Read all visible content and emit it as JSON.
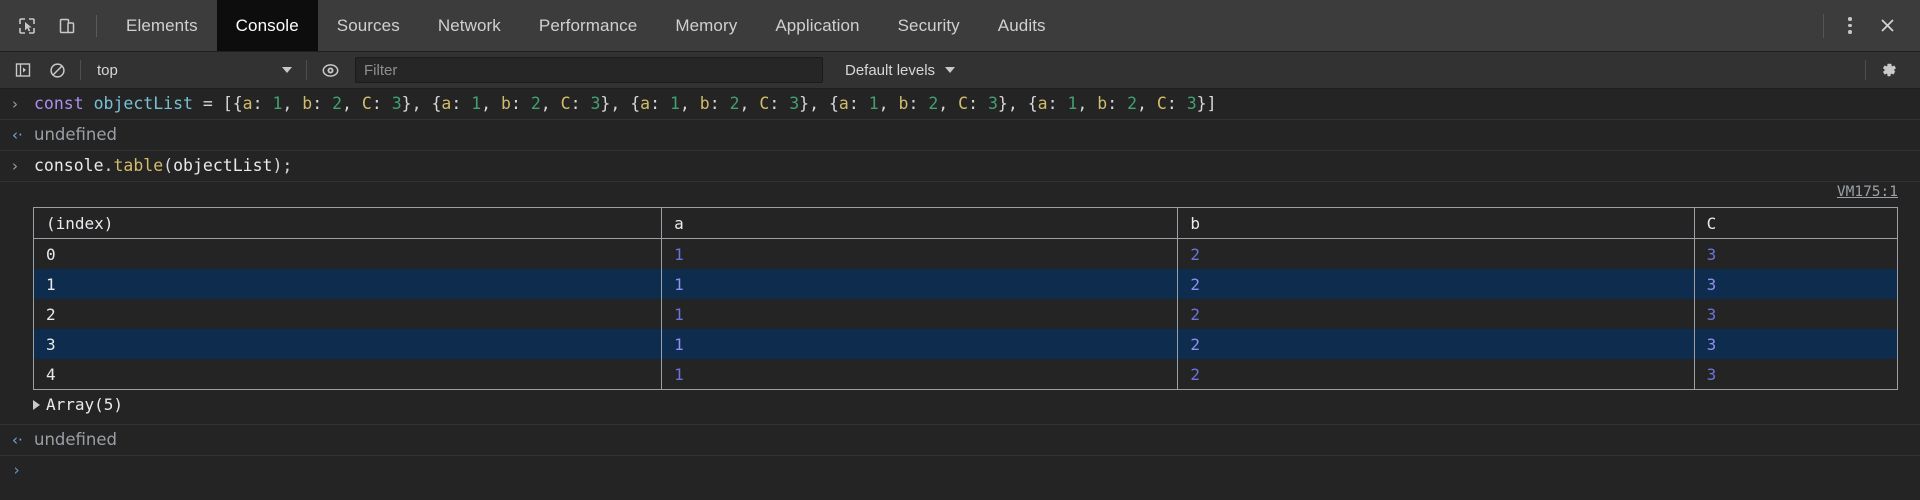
{
  "tabbar": {
    "inspect_icon": "inspect-cursor-icon",
    "device_icon": "device-toolbar-icon",
    "tabs": [
      {
        "label": "Elements",
        "active": false
      },
      {
        "label": "Console",
        "active": true
      },
      {
        "label": "Sources",
        "active": false
      },
      {
        "label": "Network",
        "active": false
      },
      {
        "label": "Performance",
        "active": false
      },
      {
        "label": "Memory",
        "active": false
      },
      {
        "label": "Application",
        "active": false
      },
      {
        "label": "Security",
        "active": false
      },
      {
        "label": "Audits",
        "active": false
      }
    ],
    "more_icon": "kebab-menu-icon",
    "close_icon": "close-icon"
  },
  "console_toolbar": {
    "sidebar_toggle_icon": "console-sidebar-icon",
    "clear_icon": "clear-console-icon",
    "context_value": "top",
    "eye_icon": "live-expression-eye-icon",
    "filter_placeholder": "Filter",
    "filter_value": "",
    "levels_label": "Default levels",
    "settings_icon": "gear-icon"
  },
  "console": {
    "messages": [
      {
        "kind": "input",
        "marker": "›",
        "tokens": [
          {
            "t": "const",
            "c": "kw"
          },
          {
            "t": " ",
            "c": "plain"
          },
          {
            "t": "objectList",
            "c": "var"
          },
          {
            "t": " ",
            "c": "plain"
          },
          {
            "t": "=",
            "c": "op"
          },
          {
            "t": " [{",
            "c": "punc"
          },
          {
            "t": "a",
            "c": "prop"
          },
          {
            "t": ": ",
            "c": "punc"
          },
          {
            "t": "1",
            "c": "num"
          },
          {
            "t": ", ",
            "c": "punc"
          },
          {
            "t": "b",
            "c": "prop"
          },
          {
            "t": ": ",
            "c": "punc"
          },
          {
            "t": "2",
            "c": "num"
          },
          {
            "t": ", ",
            "c": "punc"
          },
          {
            "t": "C",
            "c": "prop"
          },
          {
            "t": ": ",
            "c": "punc"
          },
          {
            "t": "3",
            "c": "num"
          },
          {
            "t": "}, {",
            "c": "punc"
          },
          {
            "t": "a",
            "c": "prop"
          },
          {
            "t": ": ",
            "c": "punc"
          },
          {
            "t": "1",
            "c": "num"
          },
          {
            "t": ", ",
            "c": "punc"
          },
          {
            "t": "b",
            "c": "prop"
          },
          {
            "t": ": ",
            "c": "punc"
          },
          {
            "t": "2",
            "c": "num"
          },
          {
            "t": ", ",
            "c": "punc"
          },
          {
            "t": "C",
            "c": "prop"
          },
          {
            "t": ": ",
            "c": "punc"
          },
          {
            "t": "3",
            "c": "num"
          },
          {
            "t": "}, {",
            "c": "punc"
          },
          {
            "t": "a",
            "c": "prop"
          },
          {
            "t": ": ",
            "c": "punc"
          },
          {
            "t": "1",
            "c": "num"
          },
          {
            "t": ", ",
            "c": "punc"
          },
          {
            "t": "b",
            "c": "prop"
          },
          {
            "t": ": ",
            "c": "punc"
          },
          {
            "t": "2",
            "c": "num"
          },
          {
            "t": ", ",
            "c": "punc"
          },
          {
            "t": "C",
            "c": "prop"
          },
          {
            "t": ": ",
            "c": "punc"
          },
          {
            "t": "3",
            "c": "num"
          },
          {
            "t": "}, {",
            "c": "punc"
          },
          {
            "t": "a",
            "c": "prop"
          },
          {
            "t": ": ",
            "c": "punc"
          },
          {
            "t": "1",
            "c": "num"
          },
          {
            "t": ", ",
            "c": "punc"
          },
          {
            "t": "b",
            "c": "prop"
          },
          {
            "t": ": ",
            "c": "punc"
          },
          {
            "t": "2",
            "c": "num"
          },
          {
            "t": ", ",
            "c": "punc"
          },
          {
            "t": "C",
            "c": "prop"
          },
          {
            "t": ": ",
            "c": "punc"
          },
          {
            "t": "3",
            "c": "num"
          },
          {
            "t": "}, {",
            "c": "punc"
          },
          {
            "t": "a",
            "c": "prop"
          },
          {
            "t": ": ",
            "c": "punc"
          },
          {
            "t": "1",
            "c": "num"
          },
          {
            "t": ", ",
            "c": "punc"
          },
          {
            "t": "b",
            "c": "prop"
          },
          {
            "t": ": ",
            "c": "punc"
          },
          {
            "t": "2",
            "c": "num"
          },
          {
            "t": ", ",
            "c": "punc"
          },
          {
            "t": "C",
            "c": "prop"
          },
          {
            "t": ": ",
            "c": "punc"
          },
          {
            "t": "3",
            "c": "num"
          },
          {
            "t": "}]",
            "c": "punc"
          }
        ]
      },
      {
        "kind": "output",
        "marker": "‹·",
        "text": "undefined"
      },
      {
        "kind": "input",
        "marker": "›",
        "tokens": [
          {
            "t": "console",
            "c": "plain"
          },
          {
            "t": ".",
            "c": "punc"
          },
          {
            "t": "table",
            "c": "fn"
          },
          {
            "t": "(",
            "c": "punc"
          },
          {
            "t": "objectList",
            "c": "plain"
          },
          {
            "t": ");",
            "c": "punc"
          }
        ]
      }
    ],
    "table_block": {
      "source_link": "VM175:1",
      "columns": [
        "(index)",
        "a",
        "b",
        "C"
      ],
      "rows": [
        {
          "index": "0",
          "a": "1",
          "b": "2",
          "C": "3"
        },
        {
          "index": "1",
          "a": "1",
          "b": "2",
          "C": "3"
        },
        {
          "index": "2",
          "a": "1",
          "b": "2",
          "C": "3"
        },
        {
          "index": "3",
          "a": "1",
          "b": "2",
          "C": "3"
        },
        {
          "index": "4",
          "a": "1",
          "b": "2",
          "C": "3"
        }
      ],
      "summary": "Array(5)"
    },
    "trailing_output": {
      "marker": "‹·",
      "text": "undefined"
    },
    "prompt_marker": "›",
    "prompt_value": ""
  },
  "colors": {
    "background": "#242424",
    "tabbar_bg": "#3c3c3c",
    "active_tab_bg": "#0d0d0d",
    "toolbar_bg": "#323232",
    "stripe": "#0d2c4e",
    "table_border": "#9aa0a6",
    "keyword": "#b08cf0",
    "variable": "#79c0d4",
    "property": "#d2bb6b",
    "number": "#42a071",
    "cell_value": "#6b74d8"
  }
}
